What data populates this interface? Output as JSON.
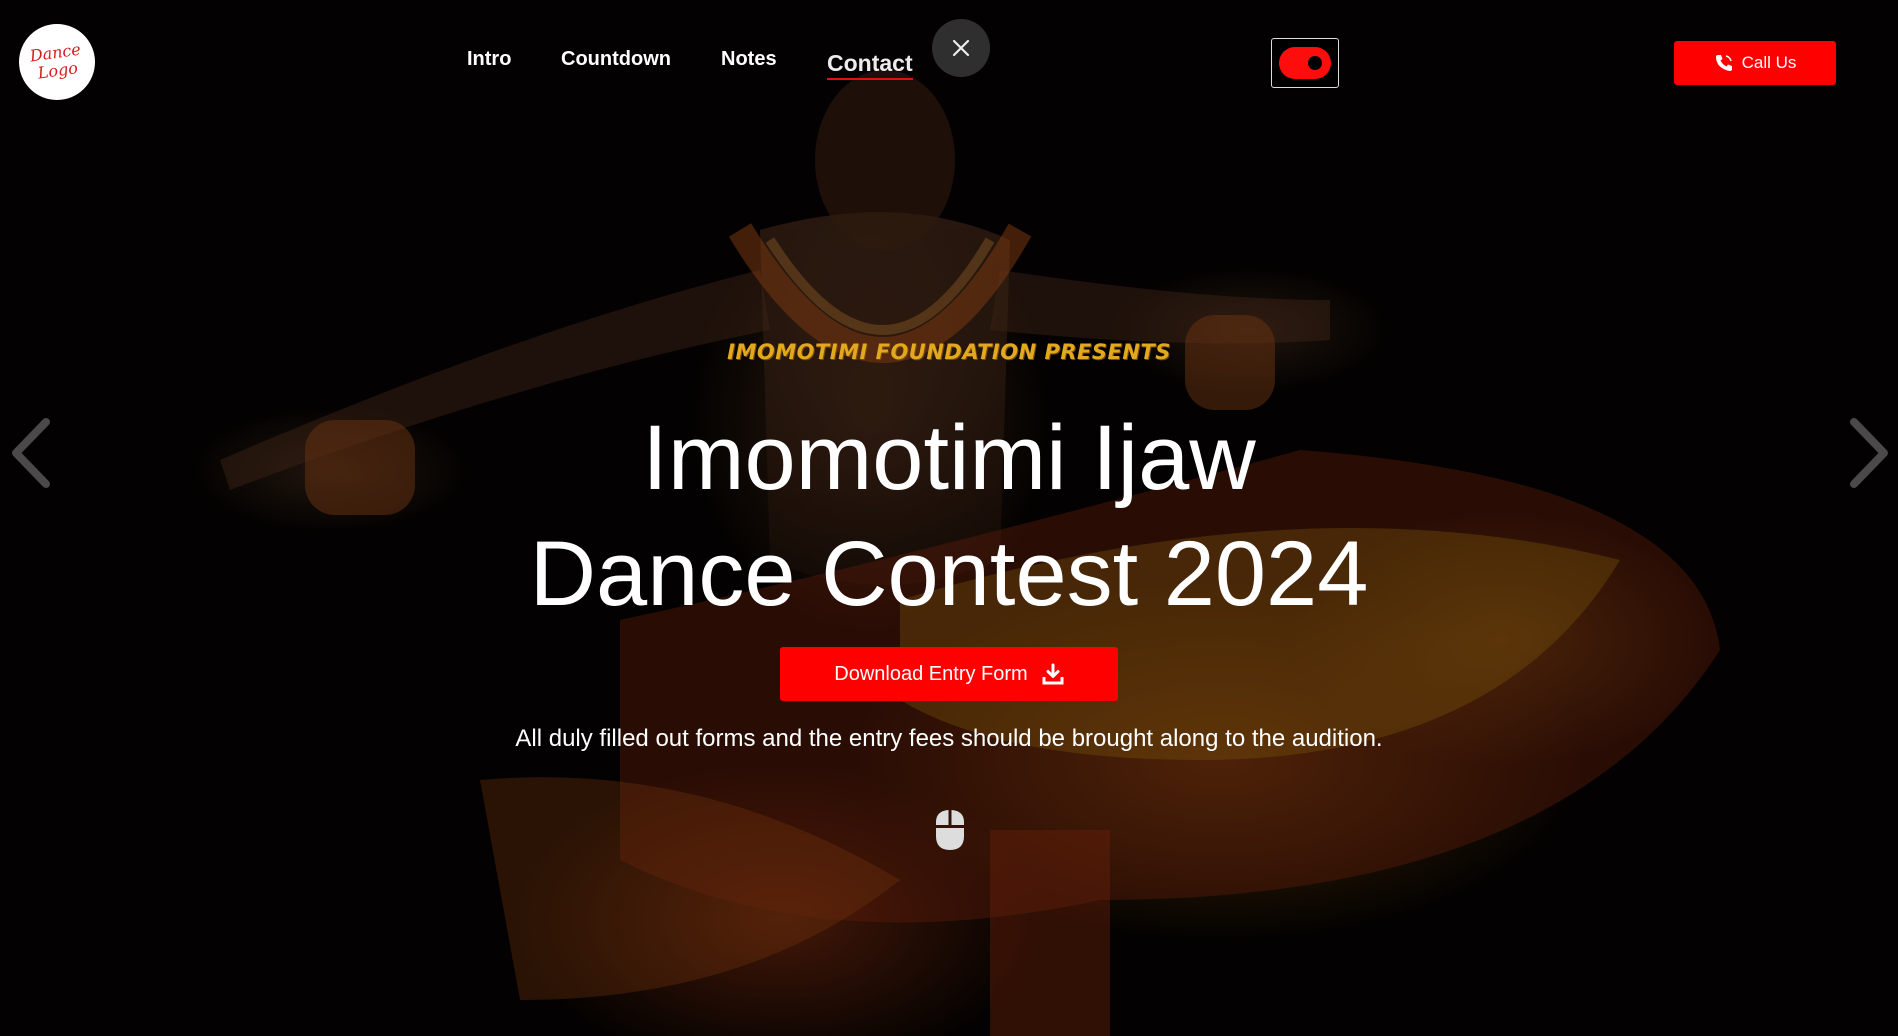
{
  "brand": {
    "logo_line1": "Dance",
    "logo_line2": "Logo"
  },
  "nav": {
    "items": [
      {
        "label": "Intro"
      },
      {
        "label": "Countdown"
      },
      {
        "label": "Notes"
      },
      {
        "label": "Contact",
        "active": true
      }
    ]
  },
  "controls": {
    "close_icon": "close-icon",
    "theme_toggle": {
      "state": "on",
      "color": "#ff0d0d"
    },
    "call_button": {
      "label": "Call Us",
      "icon": "phone-icon"
    }
  },
  "hero": {
    "presents": "IMOMOTIMI FOUNDATION PRESENTS",
    "title_line1": "Imomotimi Ijaw",
    "title_line2": "Dance Contest 2024",
    "download_button": {
      "label": "Download Entry Form",
      "icon": "download-icon"
    },
    "note": "All duly filled out forms and the entry fees should be brought along to the audition.",
    "scroll_icon": "mouse-icon"
  },
  "carousel": {
    "prev_icon": "chevron-left-icon",
    "next_icon": "chevron-right-icon"
  },
  "colors": {
    "accent": "#ff0000",
    "presents": "#e2a81e",
    "background": "#050302"
  }
}
